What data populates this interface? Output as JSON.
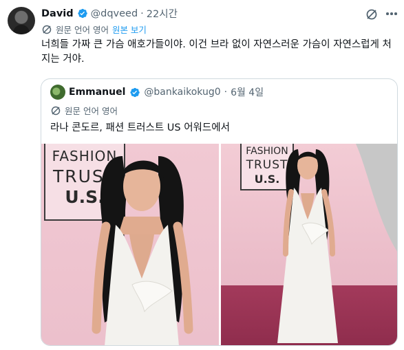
{
  "tweet": {
    "author_name": "David",
    "author_handle": "@dqveed",
    "separator": "·",
    "time": "22시간",
    "translate_label": "원문 언어 영어",
    "show_original": "원본 보기",
    "text": "너희들 가짜 큰 가슴 애호가들이야. 이건 브라 없이 자연스러운 가슴이 자연스럽게 처지는 거야."
  },
  "quote": {
    "author_name": "Emmanuel",
    "author_handle": "@bankaikokug0",
    "separator": "·",
    "date": "6월 4일",
    "translate_label": "원문 언어 영어",
    "text": "라나 콘도르, 패션 트러스트 US 어워드에서",
    "photos": [
      {
        "sign_lines": [
          "FASHION",
          "TRUST",
          "U.S."
        ]
      },
      {
        "sign_lines": [
          "FASHION",
          "TRUST",
          "U.S."
        ]
      }
    ]
  },
  "icons": {
    "verified": "verified-badge-icon",
    "grok": "grok-icon",
    "more": "more-options-icon",
    "translate": "translate-icon"
  },
  "colors": {
    "accent": "#1d9bf0",
    "text": "#0f1419",
    "muted": "#536471",
    "border": "#cfd9de"
  }
}
